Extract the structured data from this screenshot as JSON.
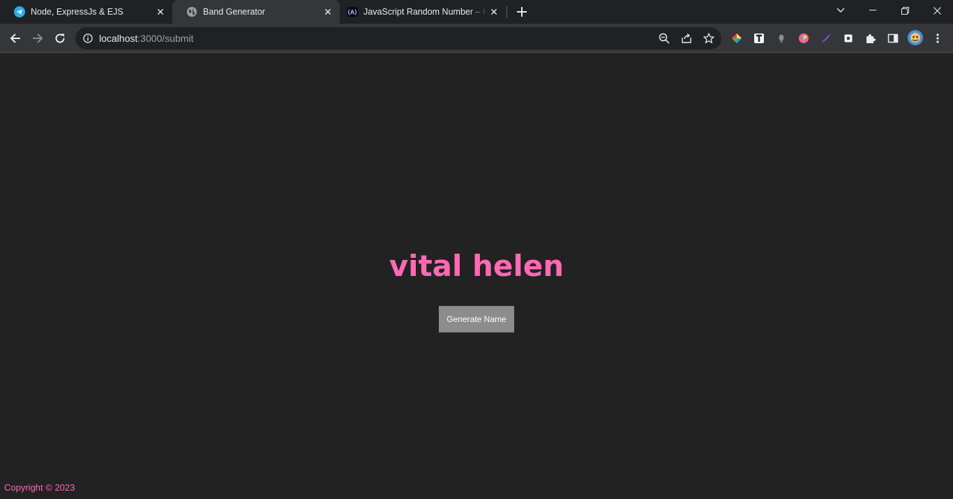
{
  "tabs": [
    {
      "title": "Node, ExpressJs & EJS",
      "icon": "telegram-icon",
      "active": false
    },
    {
      "title": "Band Generator",
      "icon": "globe-icon",
      "active": true
    },
    {
      "title": "JavaScript Random Number – How to Generate",
      "icon": "devsite-icon",
      "active": false
    }
  ],
  "address_bar": {
    "host": "localhost",
    "path": ":3000/submit"
  },
  "extensions": [
    "color-wheel-icon",
    "t-icon",
    "bulb-icon",
    "drop-icon",
    "feather-icon",
    "square-icon",
    "puzzle-icon",
    "sidepanel-icon",
    "avatar"
  ],
  "page": {
    "band_name": "vital helen",
    "button_label": "Generate Name",
    "footer": "Copyright © 2023"
  },
  "colors": {
    "accent": "#ff69b4",
    "background": "#222222",
    "button": "#8c8c8c"
  }
}
